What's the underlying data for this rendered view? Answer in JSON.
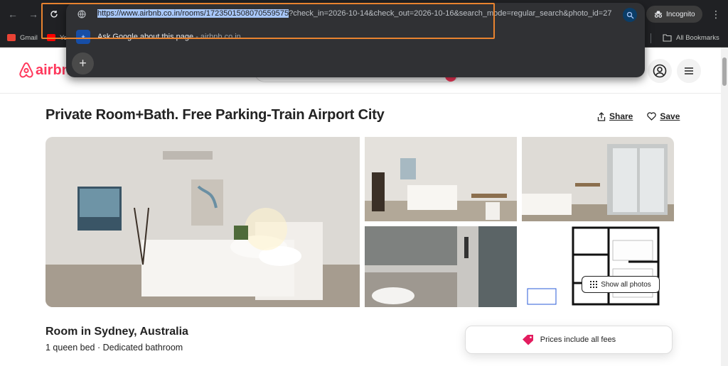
{
  "browser": {
    "url_selected": "https://www.airbnb.co.in/rooms/1723501508070559575",
    "url_rest": "?check_in=2026-10-14&check_out=2026-10-16&search_mode=regular_search&photo_id=27",
    "suggestion_text": "Ask Google about this page",
    "suggestion_sub": " - airbnb.co.in",
    "incognito_label": "Incognito",
    "bookmarks": [
      {
        "label": "Gmail",
        "color": "#ea4335"
      },
      {
        "label": "Yo",
        "color": "#ff0000"
      }
    ],
    "all_bookmarks_label": "All Bookmarks"
  },
  "header": {
    "logo_text": "airbn",
    "brand_color": "#ff385c"
  },
  "listing": {
    "title": "Private Room+Bath. Free Parking-Train Airport City",
    "share_label": "Share",
    "save_label": "Save",
    "show_all_photos": "Show all photos",
    "room_type": "Room in Sydney, Australia",
    "room_details": "1 queen bed · Dedicated bathroom",
    "price_note": "Prices include all fees"
  }
}
